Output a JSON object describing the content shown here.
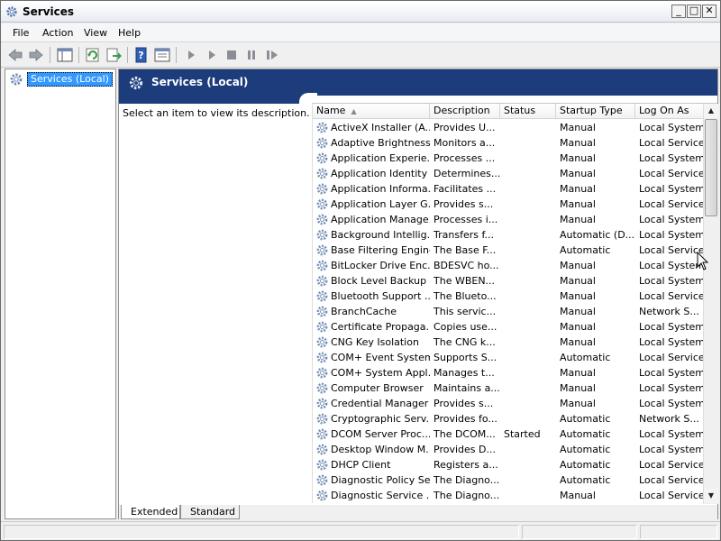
{
  "window": {
    "title": "Services",
    "minimize_glyph": "_",
    "maximize_glyph": "□",
    "close_glyph": "✕"
  },
  "menu": [
    "File",
    "Action",
    "View",
    "Help"
  ],
  "toolbar": {
    "buttons": [
      "back-icon",
      "forward-icon",
      "show-hide-console-tree-icon",
      "refresh-icon",
      "export-list-icon",
      "help-icon",
      "properties-icon",
      "start-service-icon",
      "start-service-alt-icon",
      "stop-service-icon",
      "pause-service-icon",
      "resume-service-icon"
    ]
  },
  "tree": {
    "root_label": "Services (Local)"
  },
  "header": {
    "title": "Services (Local)"
  },
  "description_pane": {
    "text": "Select an item to view its description."
  },
  "list": {
    "columns": [
      "Name",
      "Description",
      "Status",
      "Startup Type",
      "Log On As"
    ],
    "sorted_column": "Name",
    "rows": [
      [
        "ActiveX Installer (A...",
        "Provides U...",
        "",
        "Manual",
        "Local System"
      ],
      [
        "Adaptive Brightness",
        "Monitors a...",
        "",
        "Manual",
        "Local Service"
      ],
      [
        "Application Experie...",
        "Processes ...",
        "",
        "Manual",
        "Local System"
      ],
      [
        "Application Identity",
        "Determines...",
        "",
        "Manual",
        "Local Service"
      ],
      [
        "Application Informa...",
        "Facilitates ...",
        "",
        "Manual",
        "Local System"
      ],
      [
        "Application Layer G...",
        "Provides s...",
        "",
        "Manual",
        "Local Service"
      ],
      [
        "Application Manage...",
        "Processes i...",
        "",
        "Manual",
        "Local System"
      ],
      [
        "Background Intellig...",
        "Transfers f...",
        "",
        "Automatic (D...",
        "Local System"
      ],
      [
        "Base Filtering Engine",
        "The Base F...",
        "",
        "Automatic",
        "Local Service"
      ],
      [
        "BitLocker Drive Enc...",
        "BDESVC ho...",
        "",
        "Manual",
        "Local System"
      ],
      [
        "Block Level Backup ...",
        "The WBEN...",
        "",
        "Manual",
        "Local System"
      ],
      [
        "Bluetooth Support ...",
        "The Blueto...",
        "",
        "Manual",
        "Local Service"
      ],
      [
        "BranchCache",
        "This servic...",
        "",
        "Manual",
        "Network S..."
      ],
      [
        "Certificate Propaga...",
        "Copies use...",
        "",
        "Manual",
        "Local System"
      ],
      [
        "CNG Key Isolation",
        "The CNG k...",
        "",
        "Manual",
        "Local System"
      ],
      [
        "COM+ Event System",
        "Supports S...",
        "",
        "Automatic",
        "Local Service"
      ],
      [
        "COM+ System Appl...",
        "Manages t...",
        "",
        "Manual",
        "Local System"
      ],
      [
        "Computer Browser",
        "Maintains a...",
        "",
        "Manual",
        "Local System"
      ],
      [
        "Credential Manager",
        "Provides s...",
        "",
        "Manual",
        "Local System"
      ],
      [
        "Cryptographic Serv...",
        "Provides fo...",
        "",
        "Automatic",
        "Network S..."
      ],
      [
        "DCOM Server Proc...",
        "The DCOM...",
        "Started",
        "Automatic",
        "Local System"
      ],
      [
        "Desktop Window M...",
        "Provides D...",
        "",
        "Automatic",
        "Local System"
      ],
      [
        "DHCP Client",
        "Registers a...",
        "",
        "Automatic",
        "Local Service"
      ],
      [
        "Diagnostic Policy Se...",
        "The Diagno...",
        "",
        "Automatic",
        "Local Service"
      ],
      [
        "Diagnostic Service ...",
        "The Diagno...",
        "",
        "Manual",
        "Local Service"
      ]
    ]
  },
  "tabs": [
    "Extended",
    "Standard"
  ],
  "active_tab": "Extended",
  "colors": {
    "header_band": "#1c3c7c",
    "selection": "#3399ff"
  }
}
